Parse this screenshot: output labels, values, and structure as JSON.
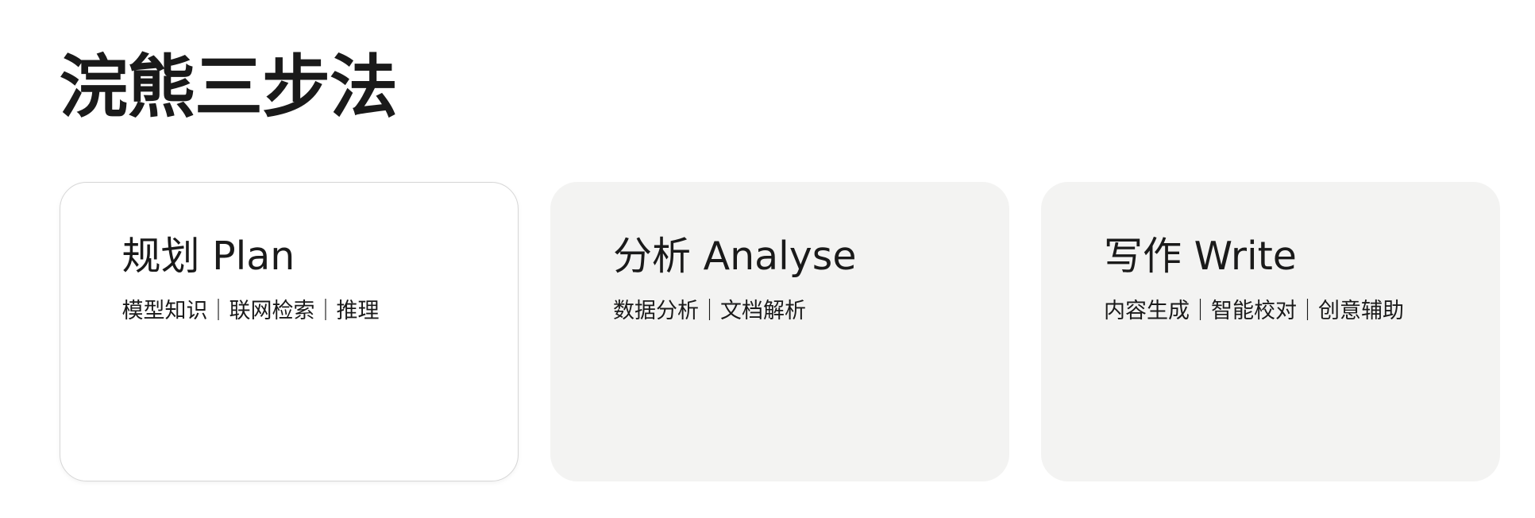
{
  "page": {
    "title": "浣熊三步法"
  },
  "cards": [
    {
      "title": "规划 Plan",
      "subtitle": "模型知识｜联网检索｜推理",
      "active": true
    },
    {
      "title": "分析 Analyse",
      "subtitle": "数据分析｜文档解析",
      "active": false
    },
    {
      "title": "写作 Write",
      "subtitle": "内容生成｜智能校对｜创意辅助",
      "active": false
    }
  ],
  "colors": {
    "card_inactive_bg": "#f3f3f2",
    "card_active_bg": "#ffffff",
    "card_active_border": "#d6d6d6",
    "text": "#1a1a1a"
  }
}
